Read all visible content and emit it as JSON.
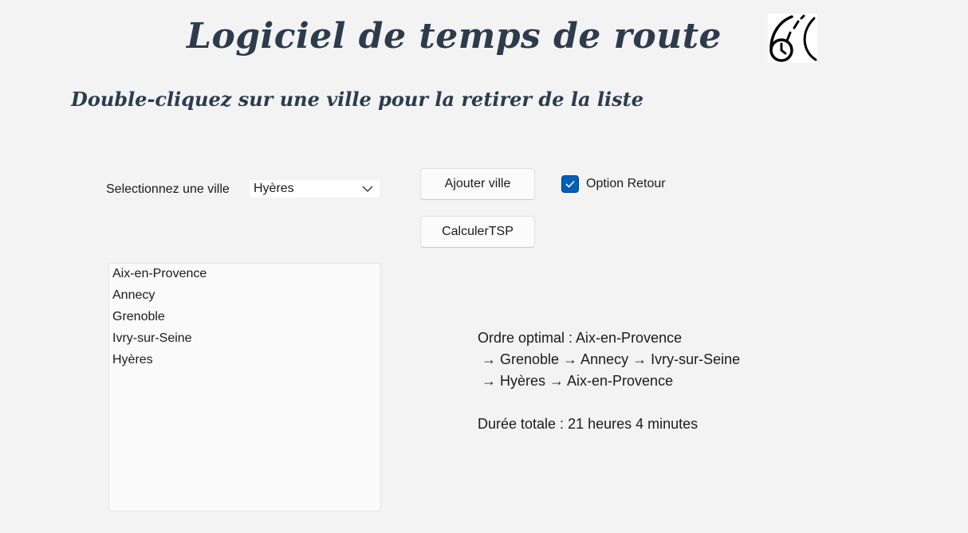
{
  "header": {
    "title": "Logiciel de temps de route",
    "subtitle": "Double-cliquez sur une ville pour la retirer de la liste",
    "logo_icon": "clock-road-icon"
  },
  "controls": {
    "select_label": "Selectionnez une ville",
    "city_select_value": "Hyères",
    "add_button_label": "Ajouter ville",
    "tsp_button_label": "CalculerTSP",
    "return_option_label": "Option Retour",
    "return_option_checked": true
  },
  "city_list": [
    "Aix-en-Provence",
    "Annecy",
    "Grenoble",
    "Ivry-sur-Seine",
    "Hyères"
  ],
  "result": {
    "line1": "Ordre optimal : Aix-en-Provence",
    "line2": " → Grenoble → Annecy → Ivry-sur-Seine",
    "line3": " → Hyères → Aix-en-Provence",
    "duration": "Durée totale : 21 heures 4 minutes"
  },
  "colors": {
    "background": "#f3f3f3",
    "heading": "#2d3b4d",
    "accent": "#005fb8"
  }
}
